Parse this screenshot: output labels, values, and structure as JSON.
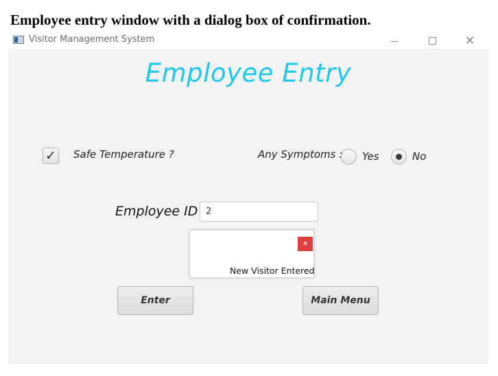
{
  "caption": "Employee entry window with a dialog box of confirmation.",
  "window": {
    "title": "Visitor Management System",
    "controls": {
      "minimize": "─",
      "maximize": "☐",
      "close": "✕"
    }
  },
  "form": {
    "heading": "Employee Entry",
    "safe_temperature": {
      "label": "Safe Temperature ?",
      "checked": true,
      "glyph": "✓"
    },
    "symptoms": {
      "label": "Any Symptoms :",
      "options": [
        {
          "label": "Yes",
          "selected": false
        },
        {
          "label": "No",
          "selected": true
        }
      ]
    },
    "employee_id": {
      "label": "Employee ID :",
      "value": "2"
    },
    "buttons": {
      "enter": "Enter",
      "main_menu": "Main Menu"
    }
  },
  "dialog": {
    "close_glyph": "×",
    "message": "New Visitor Entered"
  },
  "colors": {
    "heading": "#1fc8ea",
    "dialog_close": "#e0403d",
    "panel_bg": "#f3f3f3"
  }
}
